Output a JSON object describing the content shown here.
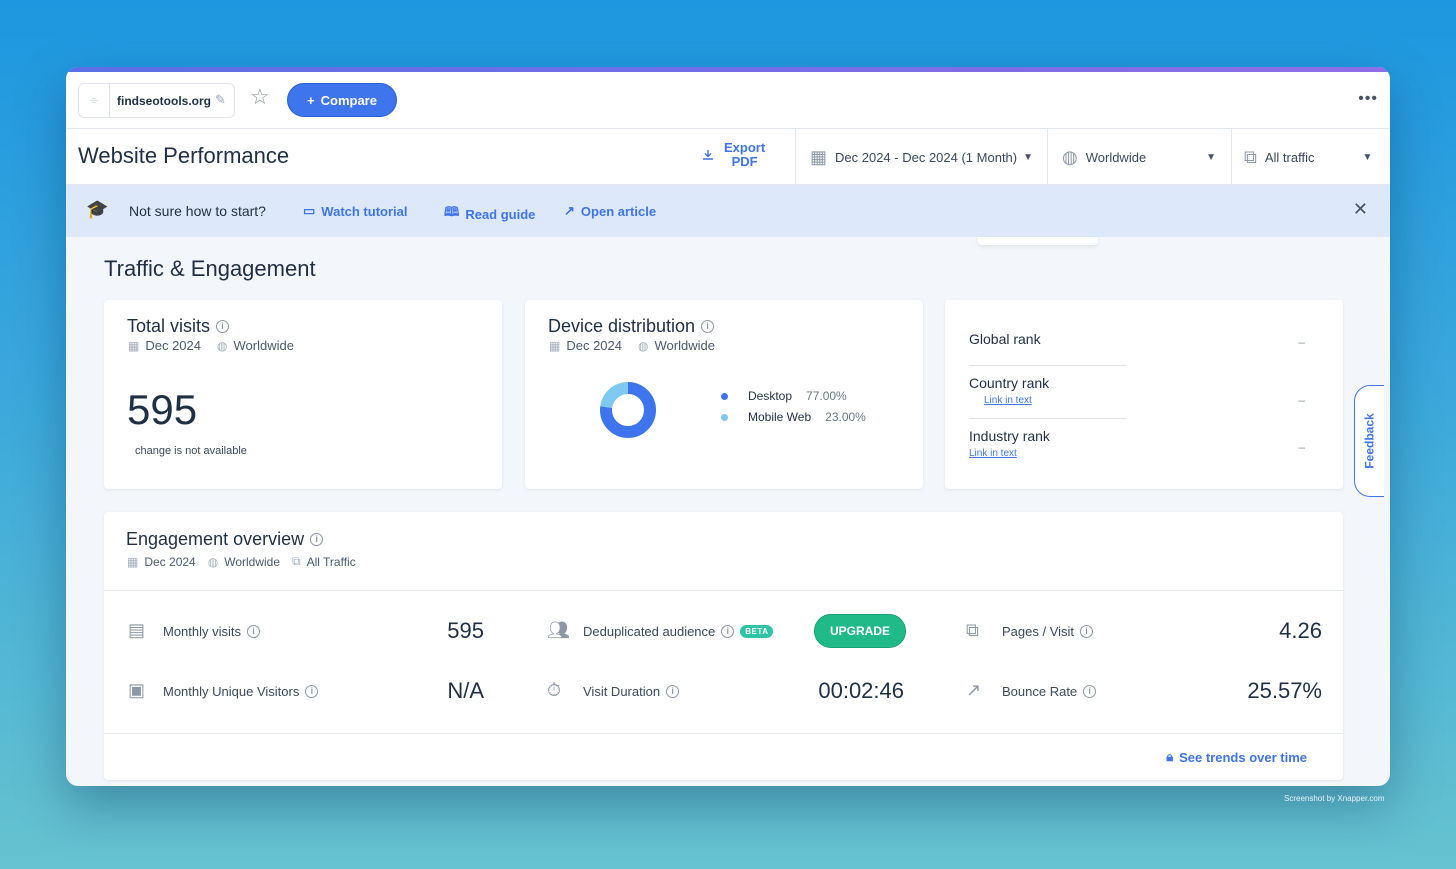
{
  "toolbar": {
    "site_name": "findseotools.org",
    "compare_label": "Compare",
    "more_label": "•••"
  },
  "header": {
    "title": "Website Performance",
    "export_label_line1": "Export",
    "export_label_line2": "PDF",
    "date_range": "Dec 2024 - Dec 2024 (1 Month)",
    "region": "Worldwide",
    "traffic": "All traffic"
  },
  "banner": {
    "text": "Not sure how to start?",
    "watch": "Watch tutorial",
    "read": "Read guide",
    "article": "Open article"
  },
  "section_title": "Traffic & Engagement",
  "total_visits": {
    "title": "Total visits",
    "date": "Dec 2024",
    "region": "Worldwide",
    "value": "595",
    "note": "change is not available"
  },
  "device": {
    "title": "Device distribution",
    "date": "Dec 2024",
    "region": "Worldwide",
    "items": [
      {
        "label": "Desktop",
        "value": "77.00%",
        "pct": 77,
        "color": "#3e74ec"
      },
      {
        "label": "Mobile Web",
        "value": "23.00%",
        "pct": 23,
        "color": "#7fc8f4"
      }
    ]
  },
  "ranks": {
    "global": {
      "label": "Global rank",
      "value": "–"
    },
    "country": {
      "label": "Country rank",
      "link": "Link in text",
      "value": "–"
    },
    "industry": {
      "label": "Industry rank",
      "link": "Link in text",
      "value": "–"
    }
  },
  "feedback_label": "Feedback",
  "engagement": {
    "title": "Engagement overview",
    "date": "Dec 2024",
    "region": "Worldwide",
    "traffic": "All Traffic",
    "monthly_visits": {
      "label": "Monthly visits",
      "value": "595"
    },
    "unique_visitors": {
      "label": "Monthly Unique Visitors",
      "value": "N/A"
    },
    "dedup": {
      "label": "Deduplicated audience",
      "badge": "BETA",
      "button": "UPGRADE"
    },
    "visit_duration": {
      "label": "Visit Duration",
      "value": "00:02:46"
    },
    "pages_visit": {
      "label": "Pages / Visit",
      "value": "4.26"
    },
    "bounce": {
      "label": "Bounce Rate",
      "value": "25.57%"
    },
    "trends": "See trends over time"
  },
  "watermark": "Screenshot by Xnapper.com"
}
